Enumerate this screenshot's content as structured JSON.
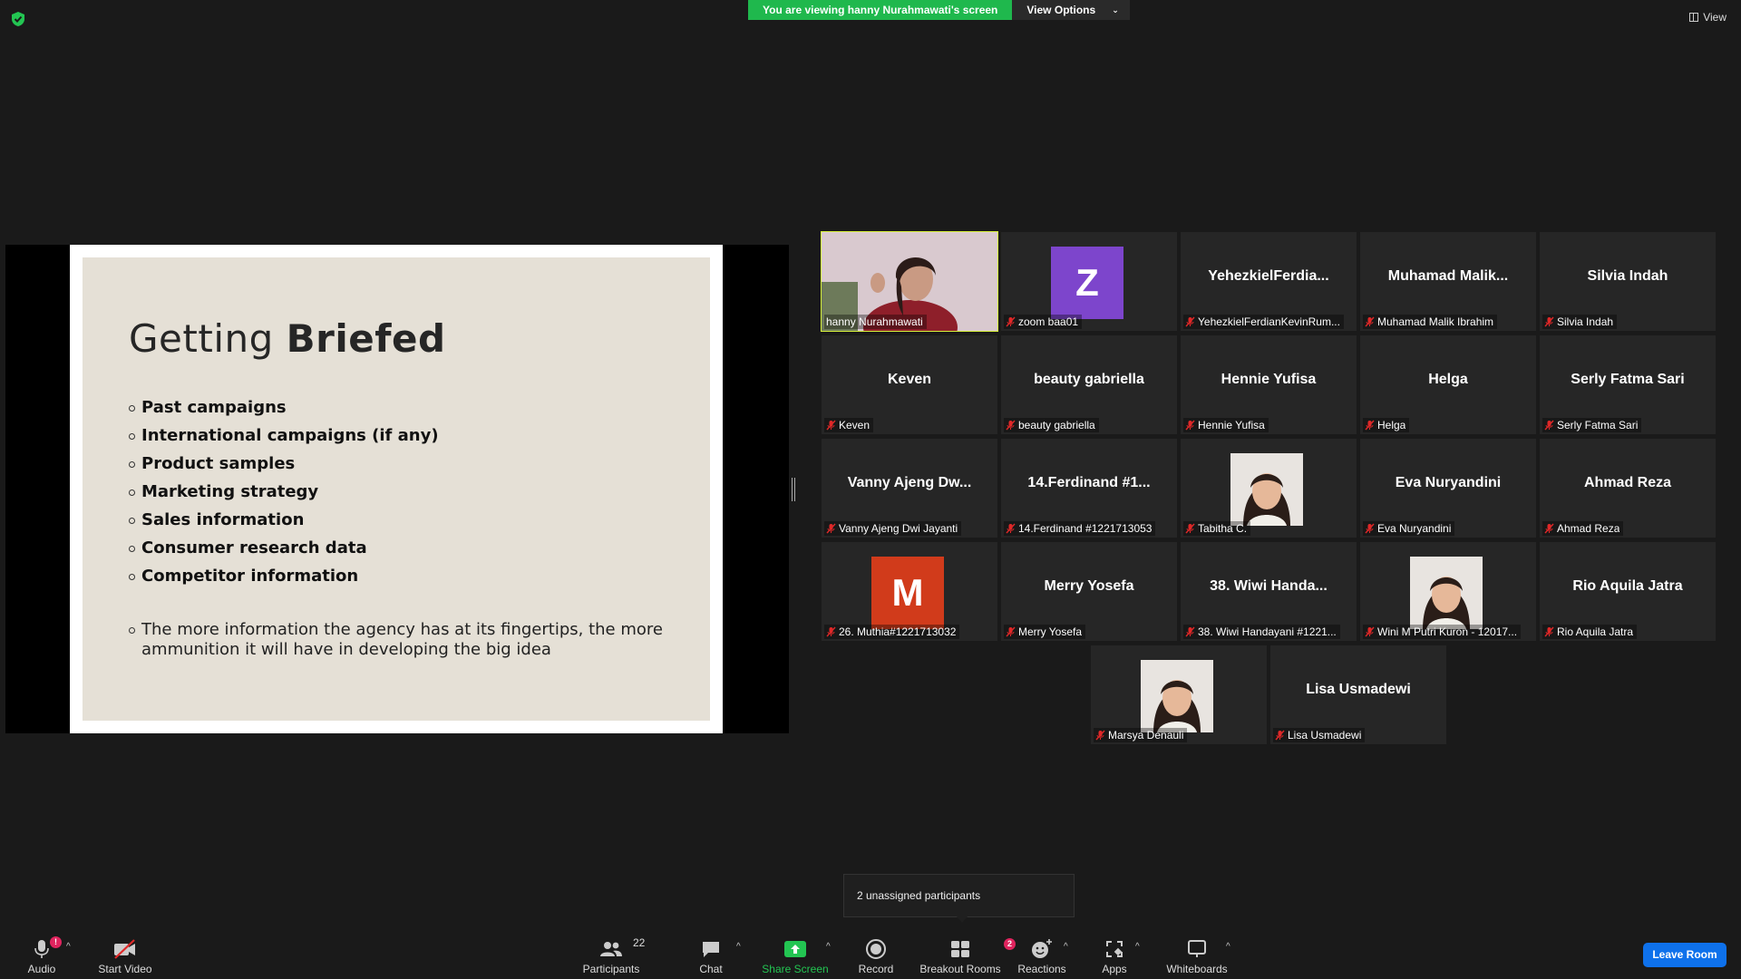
{
  "banner": {
    "viewing_text": "You are viewing hanny Nurahmawati's screen",
    "view_options": "View Options"
  },
  "view_button": "View",
  "slide": {
    "title_light": "Getting ",
    "title_bold": "Briefed",
    "bullets": [
      "Past campaigns",
      "International campaigns (if any)",
      "Product samples",
      "Marketing strategy",
      "Sales information",
      "Consumer research data",
      "Competitor information"
    ],
    "note": "The more information the agency has at its fingertips, the more ammunition it will have in developing the big idea"
  },
  "tiles": [
    {
      "big": "",
      "label": "hanny Nurahmawati",
      "muted": false,
      "kind": "video",
      "active": true
    },
    {
      "big": "",
      "label": "zoom baa01",
      "muted": true,
      "kind": "letter",
      "letter": "Z",
      "color": "#7d45cc"
    },
    {
      "big": "YehezkielFerdia...",
      "label": "YehezkielFerdianKevinRum...",
      "muted": true,
      "kind": "name"
    },
    {
      "big": "Muhamad  Malik...",
      "label": "Muhamad Malik Ibrahim",
      "muted": true,
      "kind": "name"
    },
    {
      "big": "Silvia Indah",
      "label": "Silvia Indah",
      "muted": true,
      "kind": "name"
    },
    {
      "big": "Keven",
      "label": "Keven",
      "muted": true,
      "kind": "name"
    },
    {
      "big": "beauty gabriella",
      "label": "beauty gabriella",
      "muted": true,
      "kind": "name"
    },
    {
      "big": "Hennie Yufisa",
      "label": "Hennie Yufisa",
      "muted": true,
      "kind": "name"
    },
    {
      "big": "Helga",
      "label": "Helga",
      "muted": true,
      "kind": "name"
    },
    {
      "big": "Serly Fatma Sari",
      "label": "Serly Fatma Sari",
      "muted": true,
      "kind": "name"
    },
    {
      "big": "Vanny Ajeng Dw...",
      "label": "Vanny Ajeng Dwi Jayanti",
      "muted": true,
      "kind": "name"
    },
    {
      "big": "14.Ferdinand #1...",
      "label": "14.Ferdinand #1221713053",
      "muted": true,
      "kind": "name"
    },
    {
      "big": "",
      "label": "Tabitha C.",
      "muted": true,
      "kind": "photo"
    },
    {
      "big": "Eva Nuryandini",
      "label": "Eva Nuryandini",
      "muted": true,
      "kind": "name"
    },
    {
      "big": "Ahmad Reza",
      "label": "Ahmad Reza",
      "muted": true,
      "kind": "name"
    },
    {
      "big": "",
      "label": "26. Muthia#1221713032",
      "muted": true,
      "kind": "letter",
      "letter": "M",
      "color": "#d13b1b"
    },
    {
      "big": "Merry Yosefa",
      "label": "Merry Yosefa",
      "muted": true,
      "kind": "name"
    },
    {
      "big": "38.  Wiwi Handa...",
      "label": "38. Wiwi Handayani #1221...",
      "muted": true,
      "kind": "name"
    },
    {
      "big": "",
      "label": "Wini M Putri Kuron - 12017...",
      "muted": true,
      "kind": "photo"
    },
    {
      "big": "Rio Aquila Jatra",
      "label": "Rio Aquila Jatra",
      "muted": true,
      "kind": "name"
    },
    {
      "big": "",
      "label": "Marsya Denauli",
      "muted": true,
      "kind": "photo"
    },
    {
      "big": "Lisa Usmadewi",
      "label": "Lisa Usmadewi",
      "muted": true,
      "kind": "name"
    }
  ],
  "toast": "2 unassigned participants",
  "toolbar": {
    "audio": "Audio",
    "audio_badge": "!",
    "start_video": "Start Video",
    "participants": "Participants",
    "participants_count": "22",
    "chat": "Chat",
    "share_screen": "Share Screen",
    "record": "Record",
    "breakout_rooms": "Breakout Rooms",
    "breakout_badge": "2",
    "reactions": "Reactions",
    "apps": "Apps",
    "whiteboards": "Whiteboards",
    "leave": "Leave Room"
  },
  "colors": {
    "banner_green": "#1fb84d",
    "active_speaker": "#d6f03a",
    "leave_blue": "#0e71eb",
    "share_green": "#23c552",
    "mute_red": "#e02828"
  }
}
